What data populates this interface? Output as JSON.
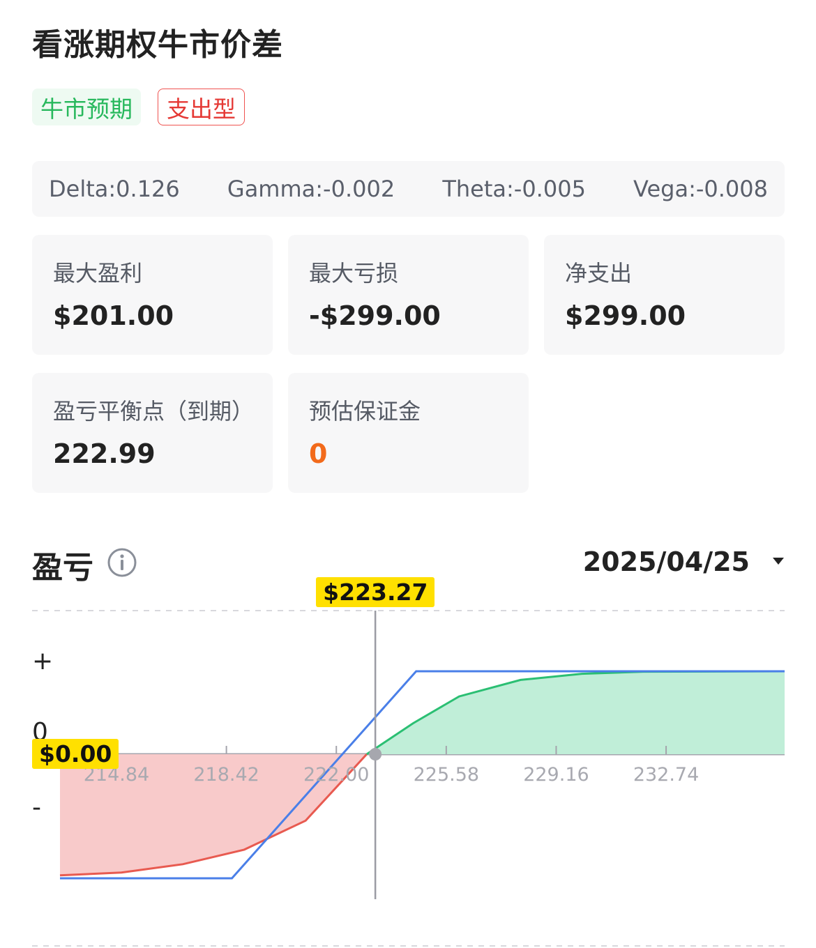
{
  "title": "看涨期权牛市价差",
  "tags": {
    "outlook": "牛市预期",
    "type": "支出型"
  },
  "greeks": {
    "delta": "Delta:0.126",
    "gamma": "Gamma:-0.002",
    "theta": "Theta:-0.005",
    "vega": "Vega:-0.008"
  },
  "stats": {
    "max_profit": {
      "label": "最大盈利",
      "value": "$201.00"
    },
    "max_loss": {
      "label": "最大亏损",
      "value": "-$299.00"
    },
    "net_debit": {
      "label": "净支出",
      "value": "$299.00"
    },
    "breakeven": {
      "label": "盈亏平衡点（到期）",
      "value": "222.99"
    },
    "margin": {
      "label": "预估保证金",
      "value": "0"
    }
  },
  "pl_section": {
    "title": "盈亏",
    "date": "2025/04/25"
  },
  "colors": {
    "profit_fill": "#c0eed8",
    "profit_line": "#2bbf73",
    "loss_fill": "#f8caca",
    "loss_line": "#e85a50",
    "expiry_line": "#4a7fe8",
    "badge": "#ffe000"
  },
  "chart_data": {
    "type": "line",
    "x_ticks": [
      "214.84",
      "218.42",
      "222.00",
      "225.58",
      "229.16",
      "232.74"
    ],
    "y_symbols": {
      "plus": "+",
      "zero": "0",
      "minus": "-"
    },
    "cursor_price_label": "$223.27",
    "cursor_price": 223.27,
    "cursor_pl_label": "$0.00",
    "breakeven": 222.99,
    "xlim": [
      213.0,
      236.6
    ],
    "ylim": [
      -299,
      201
    ],
    "series": [
      {
        "values": [
          [
            213.0,
            -299
          ],
          [
            218.6,
            -299
          ],
          [
            224.6,
            201
          ],
          [
            236.6,
            201
          ]
        ]
      },
      {
        "values": [
          [
            213.0,
            -292
          ],
          [
            215.0,
            -285
          ],
          [
            217.0,
            -265
          ],
          [
            219.0,
            -230
          ],
          [
            221.0,
            -160
          ],
          [
            222.99,
            0
          ],
          [
            224.5,
            75
          ],
          [
            226.0,
            140
          ],
          [
            228.0,
            180
          ],
          [
            230.0,
            195
          ],
          [
            232.0,
            200
          ],
          [
            236.6,
            201
          ]
        ]
      }
    ]
  }
}
